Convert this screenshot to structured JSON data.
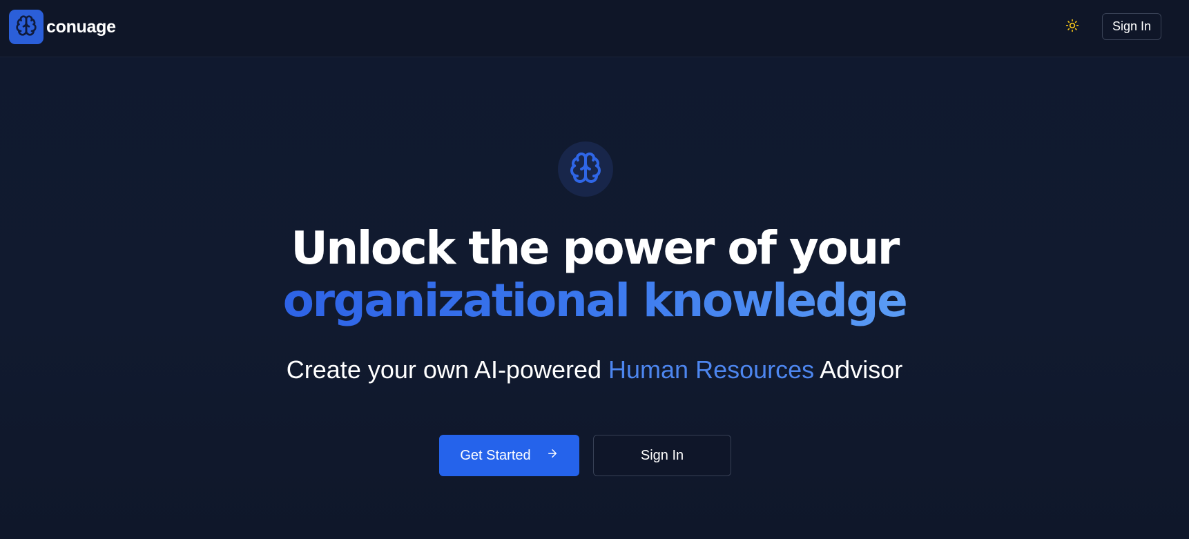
{
  "brand": {
    "name": "conuage",
    "logo_icon": "brain-icon",
    "accent": "#2563eb"
  },
  "header": {
    "theme_toggle_icon": "sun-icon",
    "sign_in_label": "Sign In"
  },
  "hero": {
    "badge_icon": "brain-icon",
    "headline_line1": "Unlock the power of your",
    "headline_line2": "organizational knowledge",
    "subhead_prefix": "Create your own AI-powered ",
    "subhead_highlight": "Human Resources",
    "subhead_suffix": " Advisor",
    "primary_cta_label": "Get Started",
    "primary_cta_icon": "arrow-right-icon",
    "secondary_cta_label": "Sign In"
  }
}
